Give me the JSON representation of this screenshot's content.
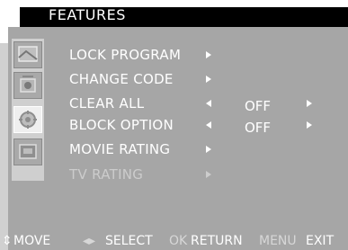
{
  "header": {
    "title": "FEATURES"
  },
  "sidebar": {
    "icons": [
      {
        "name": "picture-icon"
      },
      {
        "name": "sound-icon"
      },
      {
        "name": "features-icon"
      },
      {
        "name": "setup-icon"
      }
    ]
  },
  "menu": {
    "items": [
      {
        "label": "LOCK PROGRAM",
        "value": ""
      },
      {
        "label": "CHANGE CODE",
        "value": ""
      },
      {
        "label": "CLEAR ALL",
        "value": "OFF"
      },
      {
        "label": "BLOCK OPTION",
        "value": "OFF"
      },
      {
        "label": "MOVIE RATING",
        "value": ""
      },
      {
        "label": "TV RATING",
        "value": ""
      }
    ]
  },
  "footer": {
    "move_icon": "⇕",
    "move_label": "MOVE",
    "select_icon": "◂▸",
    "select_label": "SELECT",
    "ok_key": "OK",
    "return_label": "RETURN",
    "menu_key": "MENU",
    "exit_label": "EXIT"
  }
}
